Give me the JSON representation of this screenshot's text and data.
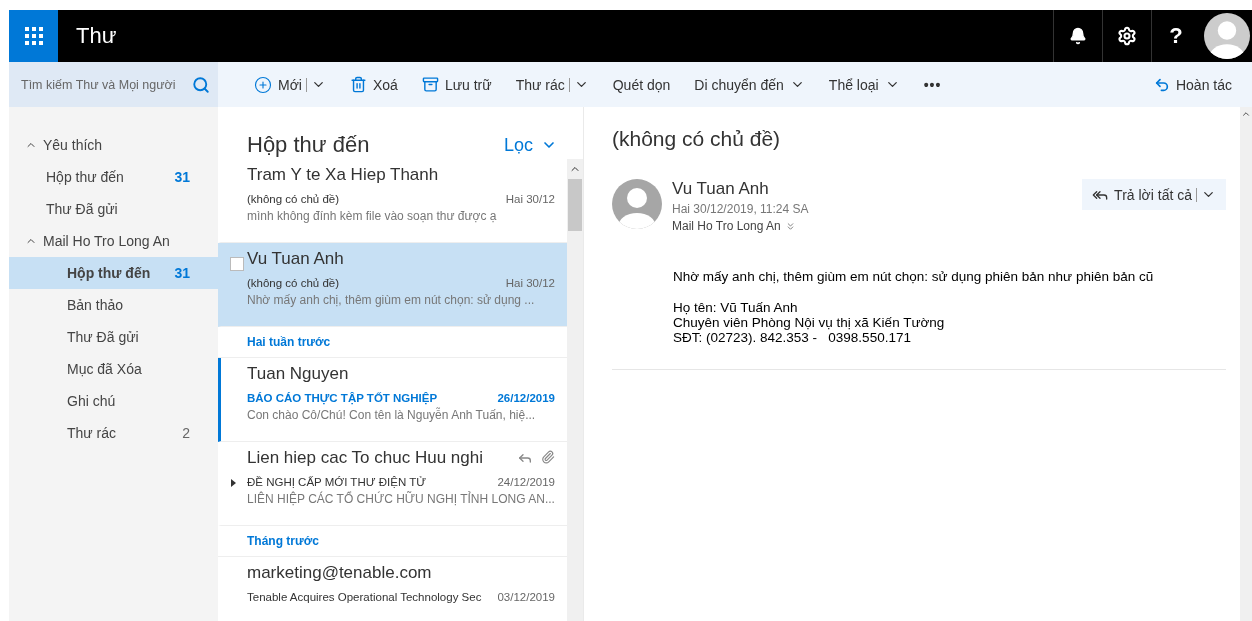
{
  "header": {
    "app_title": "Thư",
    "help": "?"
  },
  "search": {
    "placeholder": "Tìm kiếm Thư và Mọi người"
  },
  "toolbar": [
    {
      "kind": "new",
      "label": "Mới",
      "has_menu": true,
      "split": true
    },
    {
      "kind": "delete",
      "label": "Xoá",
      "has_menu": false,
      "split": false
    },
    {
      "kind": "archive",
      "label": "Lưu trữ",
      "has_menu": false,
      "split": false
    },
    {
      "kind": "junk",
      "label": "Thư rác",
      "has_menu": true,
      "split": true
    },
    {
      "kind": "sweep",
      "label": "Quét dọn",
      "has_menu": false,
      "split": false
    },
    {
      "kind": "move",
      "label": "Di chuyển đến",
      "has_menu": true,
      "split": false
    },
    {
      "kind": "categorize",
      "label": "Thể loại",
      "has_menu": true,
      "split": false
    },
    {
      "kind": "more",
      "label": "•••",
      "has_menu": false,
      "split": false
    }
  ],
  "undo": {
    "label": "Hoàn tác"
  },
  "sidebar": {
    "sections": [
      {
        "label": "Yêu thích",
        "expanded": true,
        "items": [
          {
            "label": "Hộp thư đến",
            "count": "31",
            "selected": false,
            "unread": true
          },
          {
            "label": "Thư Đã gửi",
            "selected": false
          }
        ]
      },
      {
        "label": "Mail Ho Tro Long An",
        "expanded": true,
        "items": [
          {
            "label": "Hộp thư đến",
            "count": "31",
            "selected": true,
            "unread": true
          },
          {
            "label": "Bản thảo",
            "selected": false
          },
          {
            "label": "Thư Đã gửi",
            "selected": false
          },
          {
            "label": "Mục đã Xóa",
            "selected": false
          },
          {
            "label": "Ghi chú",
            "selected": false
          },
          {
            "label": "Thư rác",
            "count": "2",
            "selected": false,
            "unread": false
          }
        ]
      }
    ]
  },
  "message_list": {
    "title": "Hộp thư đến",
    "filter": "Lọc",
    "entries": [
      {
        "kind": "message",
        "sender": "Tram Y te Xa Hiep Thanh",
        "subject": "(không có chủ đề)",
        "date": "Hai 30/12",
        "preview": "mình không đính kèm file vào soạn thư được ạ",
        "selected": false,
        "unread": false,
        "replied": false,
        "attachment": false,
        "thread": false
      },
      {
        "kind": "message",
        "sender": "Vu Tuan Anh",
        "subject": "(không có chủ đề)",
        "date": "Hai 30/12",
        "preview": "Nhờ mấy anh chị, thêm giùm em nút chọn: sử dụng ...",
        "selected": true,
        "unread": false,
        "replied": false,
        "attachment": false,
        "thread": false
      },
      {
        "kind": "group",
        "label": "Hai tuần trước"
      },
      {
        "kind": "message",
        "sender": "Tuan Nguyen",
        "subject": "BÁO CÁO THỰC TẬP TỐT NGHIỆP",
        "date": "26/12/2019",
        "preview": "Con chào Cô/Chú! Con tên là Nguyễn Anh Tuấn, hiệ...",
        "selected": false,
        "unread": true,
        "replied": false,
        "attachment": false,
        "thread": false
      },
      {
        "kind": "message",
        "sender": "Lien hiep cac To chuc Huu nghi",
        "subject": "ĐỀ NGHỊ CẤP MỚI THƯ ĐIỆN TỬ",
        "date": "24/12/2019",
        "preview": "LIÊN HIỆP CÁC TỔ CHỨC HỮU NGHỊ TỈNH LONG AN...",
        "selected": false,
        "unread": false,
        "replied": true,
        "attachment": true,
        "thread": true
      },
      {
        "kind": "group",
        "label": "Tháng trước"
      },
      {
        "kind": "message",
        "sender": "marketing@tenable.com",
        "subject": "Tenable Acquires Operational Technology Sec",
        "date": "03/12/2019",
        "selected": false,
        "unread": false,
        "replied": false,
        "attachment": false,
        "thread": false
      }
    ]
  },
  "reading_pane": {
    "subject": "(không có chủ đề)",
    "sender": "Vu Tuan Anh",
    "date": "Hai 30/12/2019, 11:24 SA",
    "recipient": "Mail Ho Tro Long An",
    "reply_all": "Trả lời tất cả",
    "body": [
      [
        "Nhờ mấy anh chị, thêm giùm em nút chọn: sử dụng phiên bản như phiên bản cũ"
      ],
      [
        "Họ tên: Vũ Tuấn Anh",
        "Chuyên viên Phòng Nội vụ thị xã Kiến Tường",
        "SĐT: (02723). 842.353 -   0398.550.171"
      ]
    ]
  }
}
